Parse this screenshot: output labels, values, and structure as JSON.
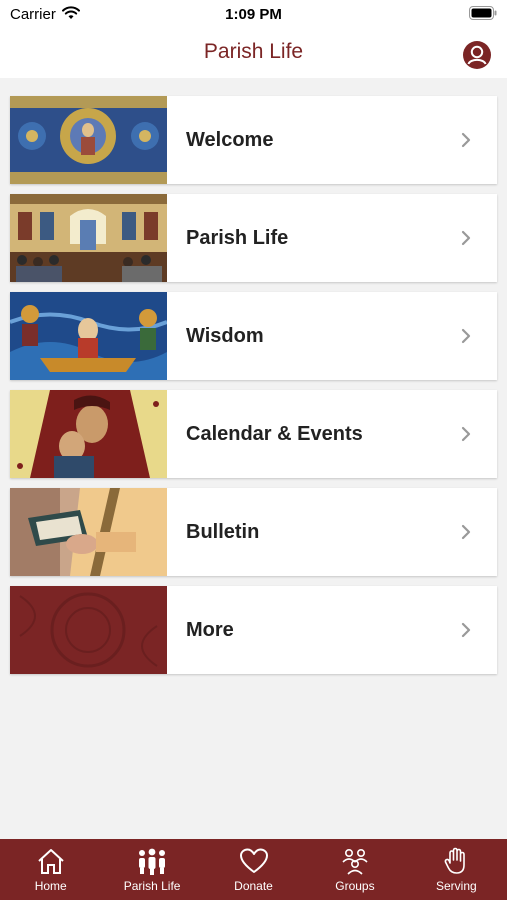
{
  "status_bar": {
    "carrier": "Carrier",
    "time": "1:09 PM"
  },
  "nav": {
    "title": "Parish Life"
  },
  "menu_items": [
    {
      "label": "Welcome"
    },
    {
      "label": "Parish Life"
    },
    {
      "label": "Wisdom"
    },
    {
      "label": "Calendar & Events"
    },
    {
      "label": "Bulletin"
    },
    {
      "label": "More"
    }
  ],
  "tabs": [
    {
      "label": "Home",
      "icon": "home-icon"
    },
    {
      "label": "Parish Life",
      "icon": "people-icon"
    },
    {
      "label": "Donate",
      "icon": "heart-icon"
    },
    {
      "label": "Groups",
      "icon": "groups-icon"
    },
    {
      "label": "Serving",
      "icon": "hand-icon"
    }
  ],
  "colors": {
    "accent": "#7b2525",
    "background": "#f2f2f2",
    "card": "#ffffff"
  }
}
